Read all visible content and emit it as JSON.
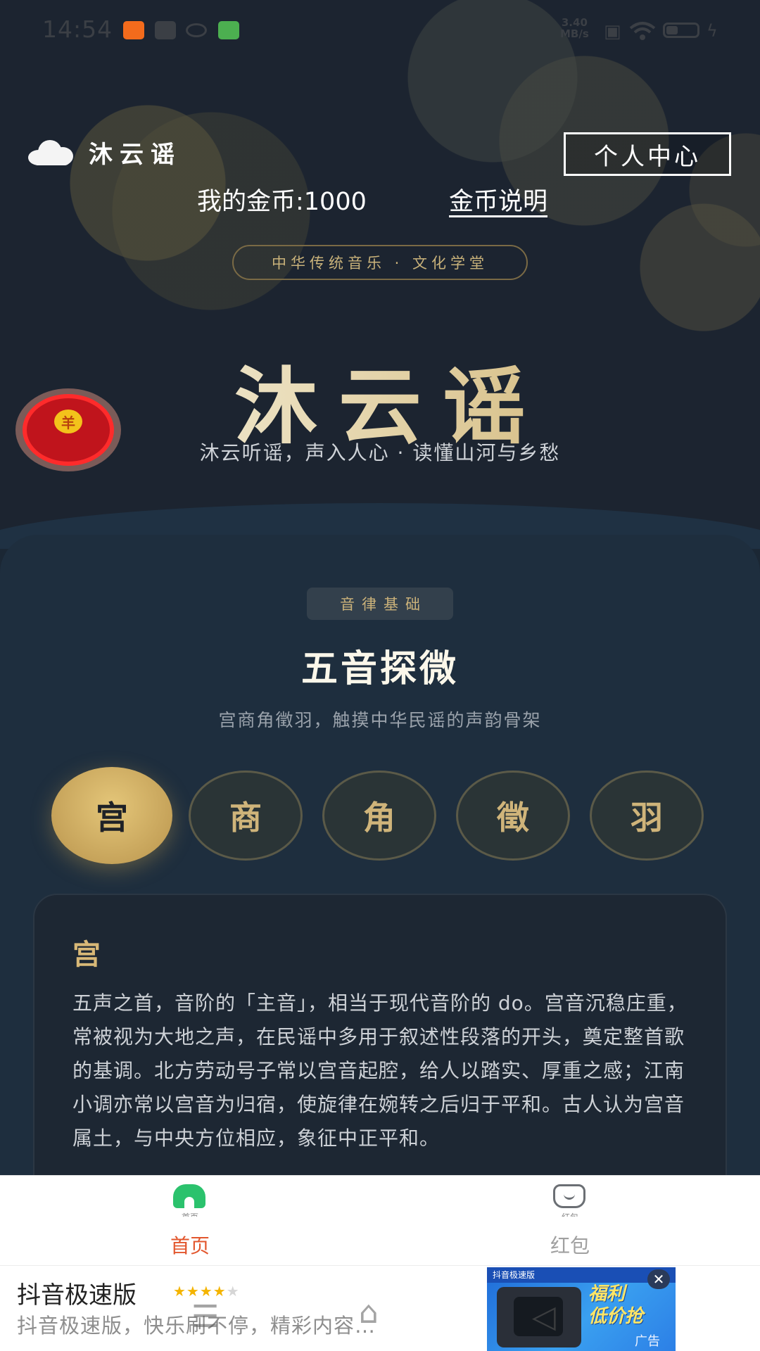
{
  "status_bar": {
    "time": "14:54",
    "net_speed_value": "3.40",
    "net_speed_unit": "MB/s",
    "app_icon_colors": [
      "#f36b1c",
      "#3b3f45",
      "#3b3f45",
      "#4caf50"
    ]
  },
  "header": {
    "brand_name": "沐云谣",
    "profile_button": "个人中心",
    "coins_label": "我的金币:1000",
    "coin_help_link": "金币说明"
  },
  "hero": {
    "tagline": "中华传统音乐 · 文化学堂",
    "title": "沐云谣",
    "subtitle": "沐云听谣，声入人心 · 读懂山河与乡愁",
    "red_packet_symbol": "羊"
  },
  "section": {
    "badge": "音律基础",
    "title": "五音探微",
    "subtitle": "宫商角徵羽，触摸中华民谣的声韵骨架"
  },
  "tones": [
    {
      "label": "宫",
      "active": true
    },
    {
      "label": "商",
      "active": false
    },
    {
      "label": "角",
      "active": false
    },
    {
      "label": "徵",
      "active": false
    },
    {
      "label": "羽",
      "active": false
    }
  ],
  "detail": {
    "title": "宫",
    "body": "五声之首，音阶的「主音」，相当于现代音阶的 do。宫音沉稳庄重，常被视为大地之声，在民谣中多用于叙述性段落的开头，奠定整首歌的基调。北方劳动号子常以宫音起腔，给人以踏实、厚重之感；江南小调亦常以宫音为归宿，使旋律在婉转之后归于平和。古人认为宫音属土，与中央方位相应，象征中正平和。"
  },
  "bottom_nav": [
    {
      "label": "首页",
      "tiny": "首页",
      "icon": "home-icon",
      "active": true,
      "color": "#e2562d"
    },
    {
      "label": "红包",
      "tiny": "红包",
      "icon": "gift-icon",
      "active": false,
      "color": "#a0a0a0"
    }
  ],
  "ad": {
    "title": "抖音极速版",
    "rating_stars": 4,
    "description": "抖音极速版，快乐刷不停，精彩内容…",
    "image_header": "抖音极速版",
    "image_promo_line1": "福利",
    "image_promo_line2": "低价抢",
    "close_symbol": "✕",
    "ad_tag": "广告"
  },
  "colors": {
    "accent_gold": "#c6a35a",
    "hero_background": "#1c2430",
    "content_background": "#1e2e3e",
    "nav_active": "#e2562d"
  }
}
